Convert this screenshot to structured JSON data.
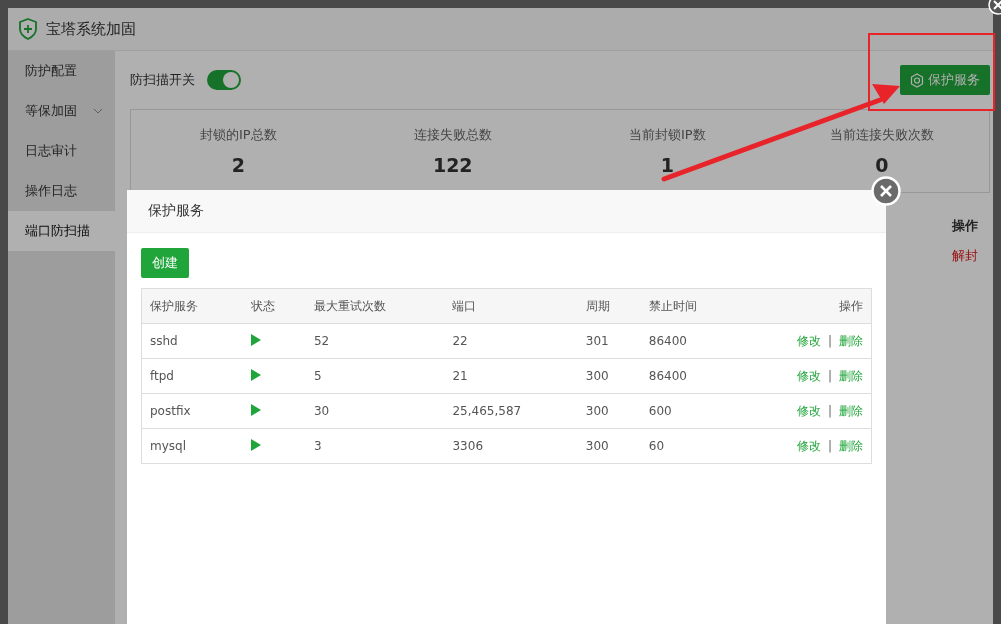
{
  "window": {
    "title": "宝塔系统加固"
  },
  "sidebar": {
    "items": [
      {
        "label": "防护配置",
        "selected": false,
        "expandable": false
      },
      {
        "label": "等保加固",
        "selected": false,
        "expandable": true
      },
      {
        "label": "日志审计",
        "selected": false,
        "expandable": false
      },
      {
        "label": "操作日志",
        "selected": false,
        "expandable": false
      },
      {
        "label": "端口防扫描",
        "selected": true,
        "expandable": false
      }
    ]
  },
  "scan_switch": {
    "label": "防扫描开关",
    "on": true
  },
  "protect_button": "保护服务",
  "stats": [
    {
      "label": "封锁的IP总数",
      "value": "2"
    },
    {
      "label": "连接失败总数",
      "value": "122"
    },
    {
      "label": "当前封锁IP数",
      "value": "1"
    },
    {
      "label": "当前连接失败次数",
      "value": "0"
    }
  ],
  "background_table": {
    "columns": [
      "操作"
    ],
    "rows": [
      [
        "解封"
      ]
    ]
  },
  "dialog": {
    "title": "保护服务",
    "create_button": "创建",
    "table": {
      "columns": [
        "保护服务",
        "状态",
        "最大重试次数",
        "端口",
        "周期",
        "禁止时间",
        "操作"
      ],
      "rows": [
        {
          "service": "sshd",
          "running": true,
          "max_retry": "52",
          "port": "22",
          "period": "301",
          "ban_time": "86400",
          "actions": [
            "修改",
            "|",
            "删除"
          ]
        },
        {
          "service": "ftpd",
          "running": true,
          "max_retry": "5",
          "port": "21",
          "period": "300",
          "ban_time": "86400",
          "actions": [
            "修改",
            "|",
            "删除"
          ]
        },
        {
          "service": "postfix",
          "running": true,
          "max_retry": "30",
          "port": "25,465,587",
          "period": "300",
          "ban_time": "600",
          "actions": [
            "修改",
            "|",
            "删除"
          ]
        },
        {
          "service": "mysql",
          "running": true,
          "max_retry": "3",
          "port": "3306",
          "period": "300",
          "ban_time": "60",
          "actions": [
            "修改",
            "|",
            "删除"
          ]
        }
      ]
    }
  }
}
